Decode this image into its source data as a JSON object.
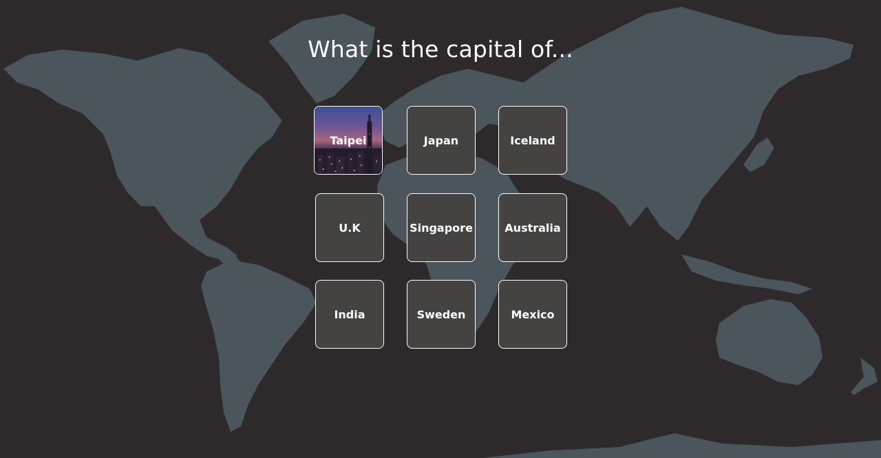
{
  "header": {
    "title": "What is the capital of..."
  },
  "cards": [
    {
      "label": "Taipei",
      "state": "revealed",
      "image": "taipei-skyline-image"
    },
    {
      "label": "Japan",
      "state": "hidden"
    },
    {
      "label": "Iceland",
      "state": "hidden"
    },
    {
      "label": "U.K",
      "state": "hidden"
    },
    {
      "label": "Singapore",
      "state": "hidden"
    },
    {
      "label": "Australia",
      "state": "hidden"
    },
    {
      "label": "India",
      "state": "hidden"
    },
    {
      "label": "Sweden",
      "state": "hidden"
    },
    {
      "label": "Mexico",
      "state": "hidden"
    }
  ],
  "colors": {
    "background": "#2e2a2b",
    "map": "#4a555c",
    "card": "#454342",
    "card_border": "#ffffff",
    "text": "#ffffff"
  }
}
